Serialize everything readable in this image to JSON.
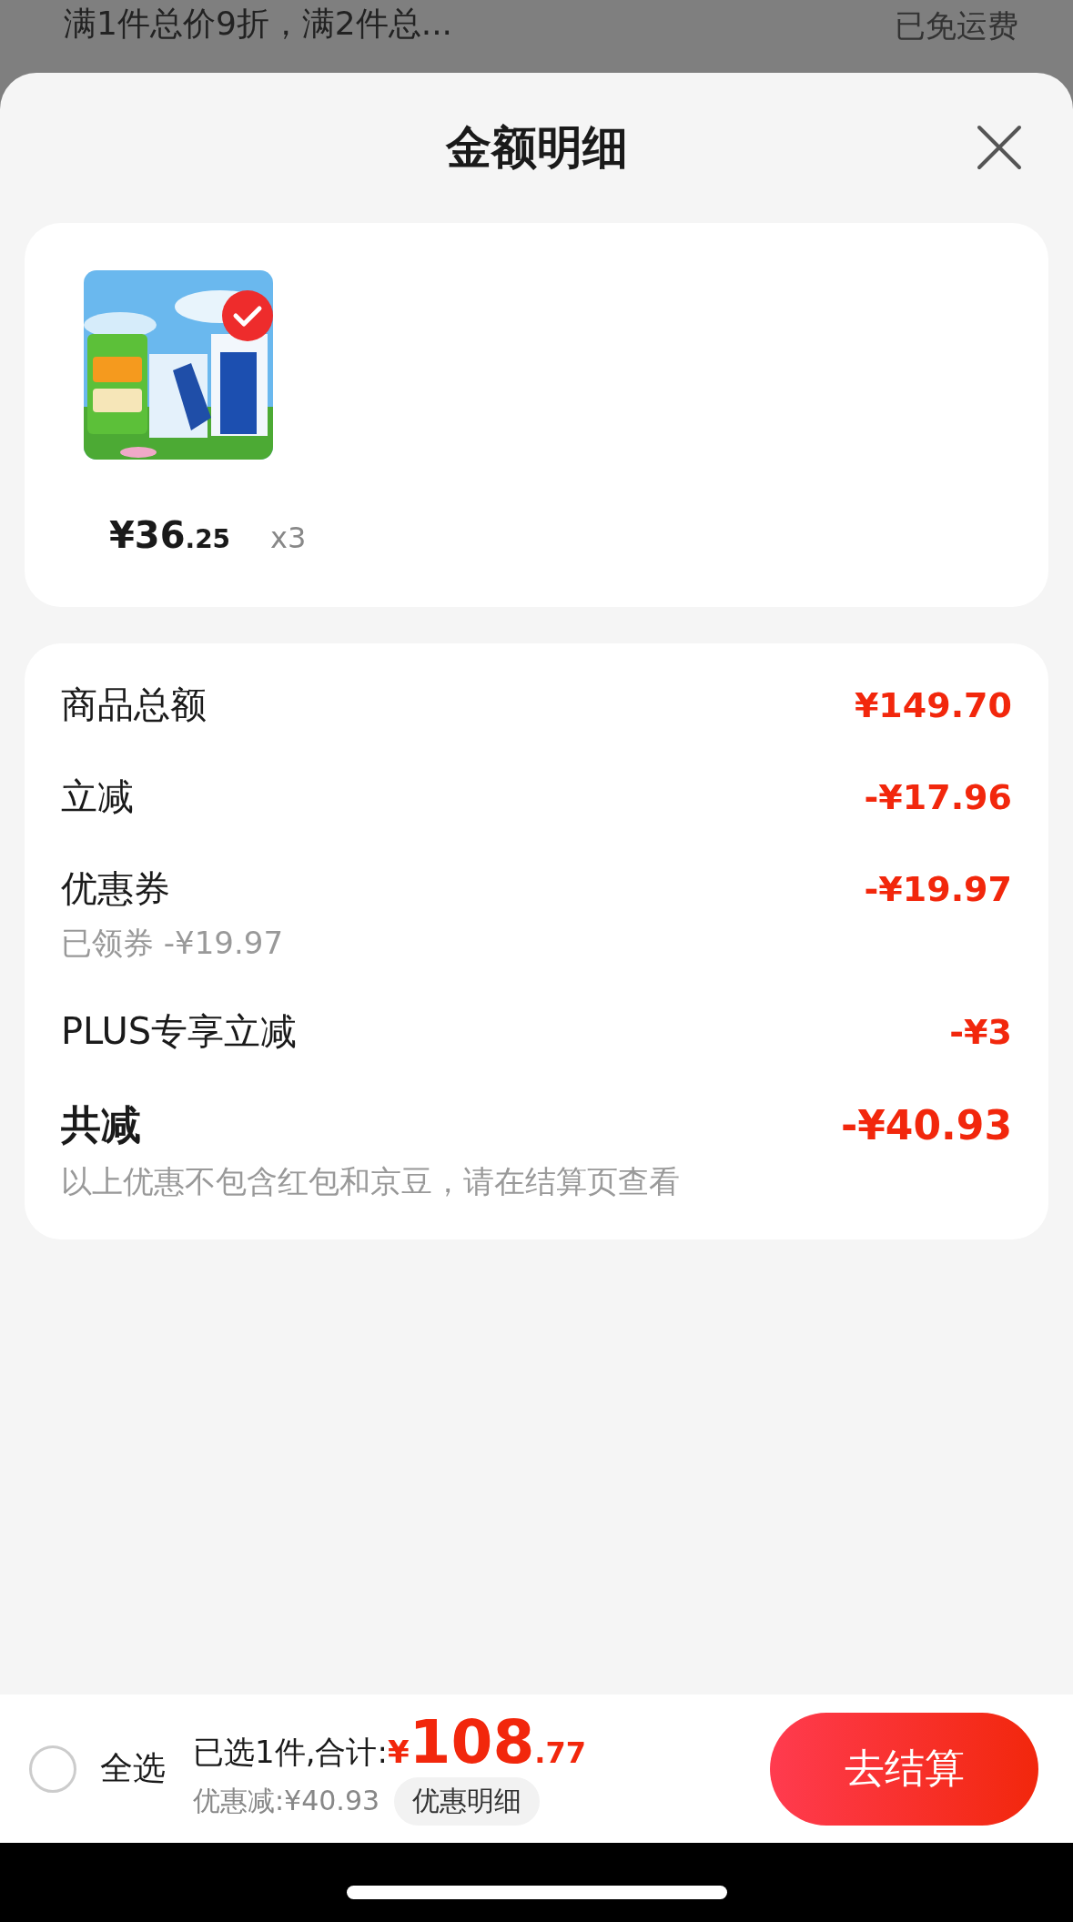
{
  "background": {
    "promo": "满1件总价9折，满2件总...",
    "shipping": "已免运费"
  },
  "sheet": {
    "title": "金额明细"
  },
  "product": {
    "price_main": "¥36",
    "price_cents": ".25",
    "quantity": "x3",
    "selected": true
  },
  "summary": {
    "rows": [
      {
        "kind": "line",
        "label": "商品总额",
        "value": "¥149.70"
      },
      {
        "kind": "line",
        "label": "立减",
        "value": "-¥17.96"
      },
      {
        "kind": "line",
        "label": "优惠券",
        "value": "-¥19.97",
        "note": "已领券 -¥19.97"
      },
      {
        "kind": "line",
        "label": "PLUS专享立减",
        "value": "-¥3"
      },
      {
        "kind": "total",
        "label": "共减",
        "value": "-¥40.93",
        "note": "以上优惠不包含红包和京豆，请在结算页查看"
      }
    ]
  },
  "footer": {
    "select_all": {
      "label": "全选",
      "checked": false
    },
    "selected_text": "已选1件,合计:",
    "currency": "¥",
    "total_main": "108",
    "total_cents": ".77",
    "discount": "优惠减:¥40.93",
    "detail_button": "优惠明细",
    "checkout_button": "去结算"
  }
}
